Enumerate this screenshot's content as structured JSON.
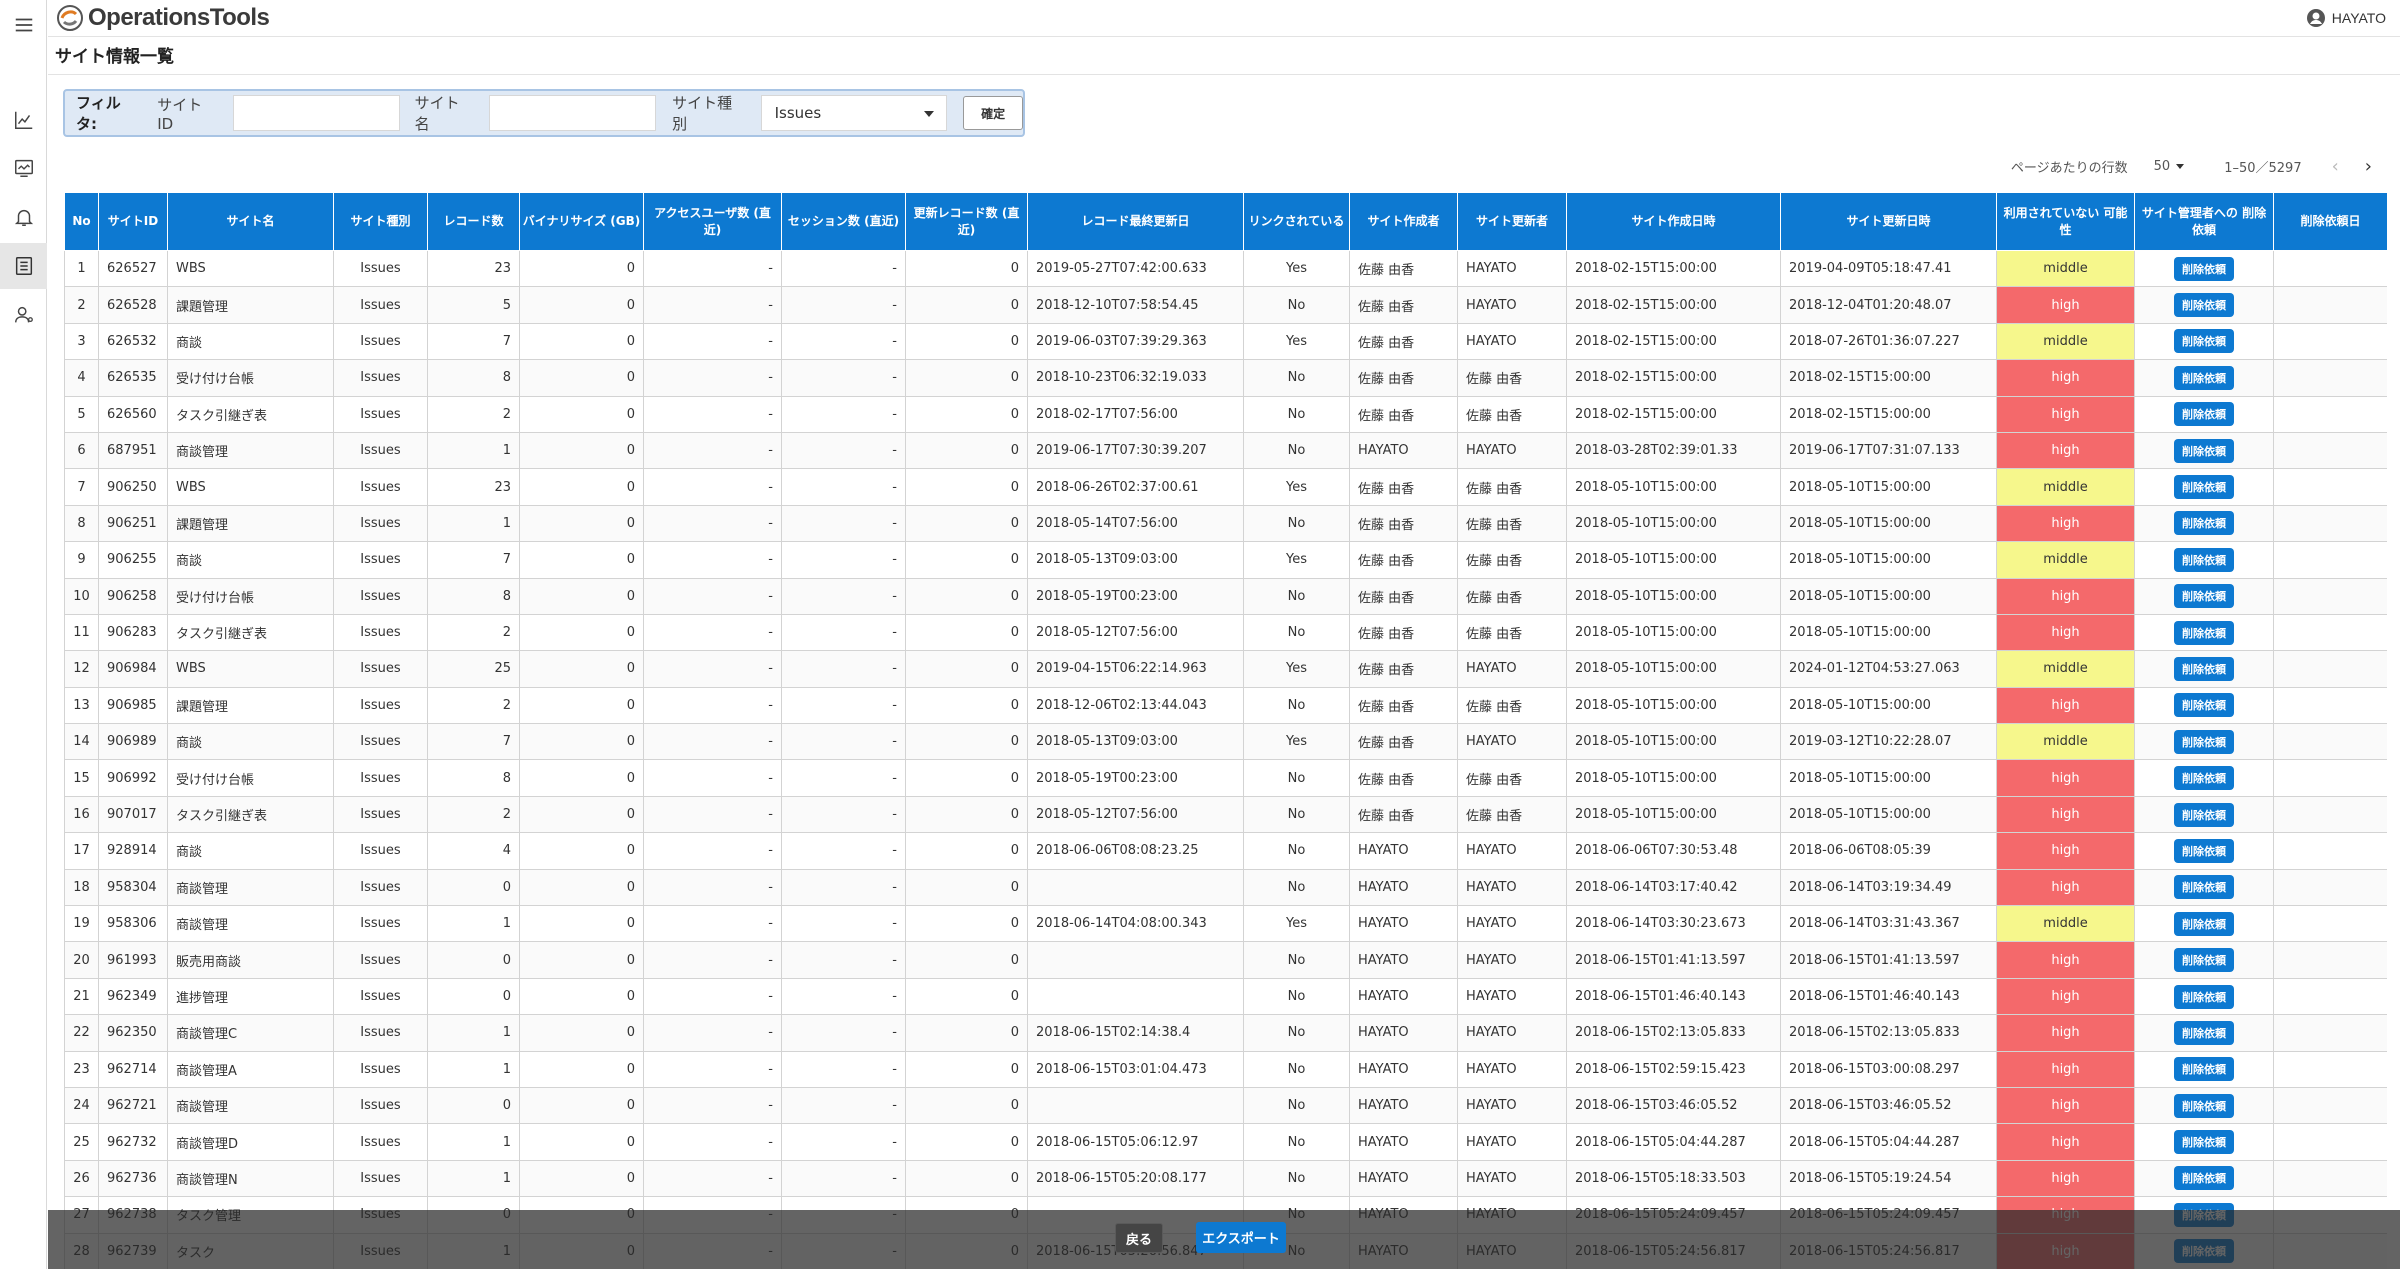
{
  "app": {
    "name": "OperationsTools",
    "user": "HAYATO"
  },
  "page": {
    "title": "サイト情報一覧"
  },
  "filter": {
    "label": "フィルタ:",
    "site_id_label": "サイトID",
    "site_id_value": "",
    "site_name_label": "サイト名",
    "site_name_value": "",
    "site_type_label": "サイト種別",
    "site_type_value": "Issues",
    "confirm": "確定"
  },
  "pager": {
    "rows_label": "ページあたりの行数",
    "rows_value": "50",
    "range": "1–50／5297"
  },
  "table": {
    "headers": [
      "No",
      "サイトID",
      "サイト名",
      "サイト種別",
      "レコード数",
      "バイナリサイズ (GB)",
      "アクセスユーザ数 (直近)",
      "セッション数 (直近)",
      "更新レコード数 (直近)",
      "レコード最終更新日",
      "リンクされている",
      "サイト作成者",
      "サイト更新者",
      "サイト作成日時",
      "サイト更新日時",
      "利用されていない 可能性",
      "サイト管理者への 削除依頼",
      "削除依頼日"
    ],
    "delete_label": "削除依頼",
    "rows": [
      [
        "1",
        "626527",
        "WBS",
        "Issues",
        "23",
        "0",
        "-",
        "-",
        "0",
        "2019-05-27T07:42:00.633",
        "Yes",
        "佐藤 由香",
        "HAYATO",
        "2018-02-15T15:00:00",
        "2019-04-09T05:18:47.41",
        "middle"
      ],
      [
        "2",
        "626528",
        "課題管理",
        "Issues",
        "5",
        "0",
        "-",
        "-",
        "0",
        "2018-12-10T07:58:54.45",
        "No",
        "佐藤 由香",
        "HAYATO",
        "2018-02-15T15:00:00",
        "2018-12-04T01:20:48.07",
        "high"
      ],
      [
        "3",
        "626532",
        "商談",
        "Issues",
        "7",
        "0",
        "-",
        "-",
        "0",
        "2019-06-03T07:39:29.363",
        "Yes",
        "佐藤 由香",
        "HAYATO",
        "2018-02-15T15:00:00",
        "2018-07-26T01:36:07.227",
        "middle"
      ],
      [
        "4",
        "626535",
        "受け付け台帳",
        "Issues",
        "8",
        "0",
        "-",
        "-",
        "0",
        "2018-10-23T06:32:19.033",
        "No",
        "佐藤 由香",
        "佐藤 由香",
        "2018-02-15T15:00:00",
        "2018-02-15T15:00:00",
        "high"
      ],
      [
        "5",
        "626560",
        "タスク引継ぎ表",
        "Issues",
        "2",
        "0",
        "-",
        "-",
        "0",
        "2018-02-17T07:56:00",
        "No",
        "佐藤 由香",
        "佐藤 由香",
        "2018-02-15T15:00:00",
        "2018-02-15T15:00:00",
        "high"
      ],
      [
        "6",
        "687951",
        "商談管理",
        "Issues",
        "1",
        "0",
        "-",
        "-",
        "0",
        "2019-06-17T07:30:39.207",
        "No",
        "HAYATO",
        "HAYATO",
        "2018-03-28T02:39:01.33",
        "2019-06-17T07:31:07.133",
        "high"
      ],
      [
        "7",
        "906250",
        "WBS",
        "Issues",
        "23",
        "0",
        "-",
        "-",
        "0",
        "2018-06-26T02:37:00.61",
        "Yes",
        "佐藤 由香",
        "佐藤 由香",
        "2018-05-10T15:00:00",
        "2018-05-10T15:00:00",
        "middle"
      ],
      [
        "8",
        "906251",
        "課題管理",
        "Issues",
        "1",
        "0",
        "-",
        "-",
        "0",
        "2018-05-14T07:56:00",
        "No",
        "佐藤 由香",
        "佐藤 由香",
        "2018-05-10T15:00:00",
        "2018-05-10T15:00:00",
        "high"
      ],
      [
        "9",
        "906255",
        "商談",
        "Issues",
        "7",
        "0",
        "-",
        "-",
        "0",
        "2018-05-13T09:03:00",
        "Yes",
        "佐藤 由香",
        "佐藤 由香",
        "2018-05-10T15:00:00",
        "2018-05-10T15:00:00",
        "middle"
      ],
      [
        "10",
        "906258",
        "受け付け台帳",
        "Issues",
        "8",
        "0",
        "-",
        "-",
        "0",
        "2018-05-19T00:23:00",
        "No",
        "佐藤 由香",
        "佐藤 由香",
        "2018-05-10T15:00:00",
        "2018-05-10T15:00:00",
        "high"
      ],
      [
        "11",
        "906283",
        "タスク引継ぎ表",
        "Issues",
        "2",
        "0",
        "-",
        "-",
        "0",
        "2018-05-12T07:56:00",
        "No",
        "佐藤 由香",
        "佐藤 由香",
        "2018-05-10T15:00:00",
        "2018-05-10T15:00:00",
        "high"
      ],
      [
        "12",
        "906984",
        "WBS",
        "Issues",
        "25",
        "0",
        "-",
        "-",
        "0",
        "2019-04-15T06:22:14.963",
        "Yes",
        "佐藤 由香",
        "HAYATO",
        "2018-05-10T15:00:00",
        "2024-01-12T04:53:27.063",
        "middle"
      ],
      [
        "13",
        "906985",
        "課題管理",
        "Issues",
        "2",
        "0",
        "-",
        "-",
        "0",
        "2018-12-06T02:13:44.043",
        "No",
        "佐藤 由香",
        "佐藤 由香",
        "2018-05-10T15:00:00",
        "2018-05-10T15:00:00",
        "high"
      ],
      [
        "14",
        "906989",
        "商談",
        "Issues",
        "7",
        "0",
        "-",
        "-",
        "0",
        "2018-05-13T09:03:00",
        "Yes",
        "佐藤 由香",
        "HAYATO",
        "2018-05-10T15:00:00",
        "2019-03-12T10:22:28.07",
        "middle"
      ],
      [
        "15",
        "906992",
        "受け付け台帳",
        "Issues",
        "8",
        "0",
        "-",
        "-",
        "0",
        "2018-05-19T00:23:00",
        "No",
        "佐藤 由香",
        "佐藤 由香",
        "2018-05-10T15:00:00",
        "2018-05-10T15:00:00",
        "high"
      ],
      [
        "16",
        "907017",
        "タスク引継ぎ表",
        "Issues",
        "2",
        "0",
        "-",
        "-",
        "0",
        "2018-05-12T07:56:00",
        "No",
        "佐藤 由香",
        "佐藤 由香",
        "2018-05-10T15:00:00",
        "2018-05-10T15:00:00",
        "high"
      ],
      [
        "17",
        "928914",
        "商談",
        "Issues",
        "4",
        "0",
        "-",
        "-",
        "0",
        "2018-06-06T08:08:23.25",
        "No",
        "HAYATO",
        "HAYATO",
        "2018-06-06T07:30:53.48",
        "2018-06-06T08:05:39",
        "high"
      ],
      [
        "18",
        "958304",
        "商談管理",
        "Issues",
        "0",
        "0",
        "-",
        "-",
        "0",
        "",
        "No",
        "HAYATO",
        "HAYATO",
        "2018-06-14T03:17:40.42",
        "2018-06-14T03:19:34.49",
        "high"
      ],
      [
        "19",
        "958306",
        "商談管理",
        "Issues",
        "1",
        "0",
        "-",
        "-",
        "0",
        "2018-06-14T04:08:00.343",
        "Yes",
        "HAYATO",
        "HAYATO",
        "2018-06-14T03:30:23.673",
        "2018-06-14T03:31:43.367",
        "middle"
      ],
      [
        "20",
        "961993",
        "販売用商談",
        "Issues",
        "0",
        "0",
        "-",
        "-",
        "0",
        "",
        "No",
        "HAYATO",
        "HAYATO",
        "2018-06-15T01:41:13.597",
        "2018-06-15T01:41:13.597",
        "high"
      ],
      [
        "21",
        "962349",
        "進捗管理",
        "Issues",
        "0",
        "0",
        "-",
        "-",
        "0",
        "",
        "No",
        "HAYATO",
        "HAYATO",
        "2018-06-15T01:46:40.143",
        "2018-06-15T01:46:40.143",
        "high"
      ],
      [
        "22",
        "962350",
        "商談管理C",
        "Issues",
        "1",
        "0",
        "-",
        "-",
        "0",
        "2018-06-15T02:14:38.4",
        "No",
        "HAYATO",
        "HAYATO",
        "2018-06-15T02:13:05.833",
        "2018-06-15T02:13:05.833",
        "high"
      ],
      [
        "23",
        "962714",
        "商談管理A",
        "Issues",
        "1",
        "0",
        "-",
        "-",
        "0",
        "2018-06-15T03:01:04.473",
        "No",
        "HAYATO",
        "HAYATO",
        "2018-06-15T02:59:15.423",
        "2018-06-15T03:00:08.297",
        "high"
      ],
      [
        "24",
        "962721",
        "商談管理",
        "Issues",
        "0",
        "0",
        "-",
        "-",
        "0",
        "",
        "No",
        "HAYATO",
        "HAYATO",
        "2018-06-15T03:46:05.52",
        "2018-06-15T03:46:05.52",
        "high"
      ],
      [
        "25",
        "962732",
        "商談管理D",
        "Issues",
        "1",
        "0",
        "-",
        "-",
        "0",
        "2018-06-15T05:06:12.97",
        "No",
        "HAYATO",
        "HAYATO",
        "2018-06-15T05:04:44.287",
        "2018-06-15T05:04:44.287",
        "high"
      ],
      [
        "26",
        "962736",
        "商談管理N",
        "Issues",
        "1",
        "0",
        "-",
        "-",
        "0",
        "2018-06-15T05:20:08.177",
        "No",
        "HAYATO",
        "HAYATO",
        "2018-06-15T05:18:33.503",
        "2018-06-15T05:19:24.54",
        "high"
      ],
      [
        "27",
        "962738",
        "タスク管理",
        "Issues",
        "0",
        "0",
        "-",
        "-",
        "0",
        "",
        "No",
        "HAYATO",
        "HAYATO",
        "2018-06-15T05:24:09.457",
        "2018-06-15T05:24:09.457",
        "high"
      ],
      [
        "28",
        "962739",
        "タスク",
        "Issues",
        "1",
        "0",
        "-",
        "-",
        "0",
        "2018-06-15T05:26:56.847",
        "No",
        "HAYATO",
        "HAYATO",
        "2018-06-15T05:24:56.817",
        "2018-06-15T05:24:56.817",
        "high"
      ]
    ]
  },
  "footer": {
    "back": "戻る",
    "export": "エクスポート"
  },
  "colors": {
    "primary": "#0d79d1",
    "high": "#f4696b",
    "middle": "#f6f78c",
    "filter_bg": "#dfe9f5"
  },
  "sidebar": {
    "icons": [
      "menu-icon",
      "chart-line-icon",
      "monitor-chart-icon",
      "bell-icon",
      "list-icon",
      "user-settings-icon"
    ],
    "active": "list-icon"
  }
}
